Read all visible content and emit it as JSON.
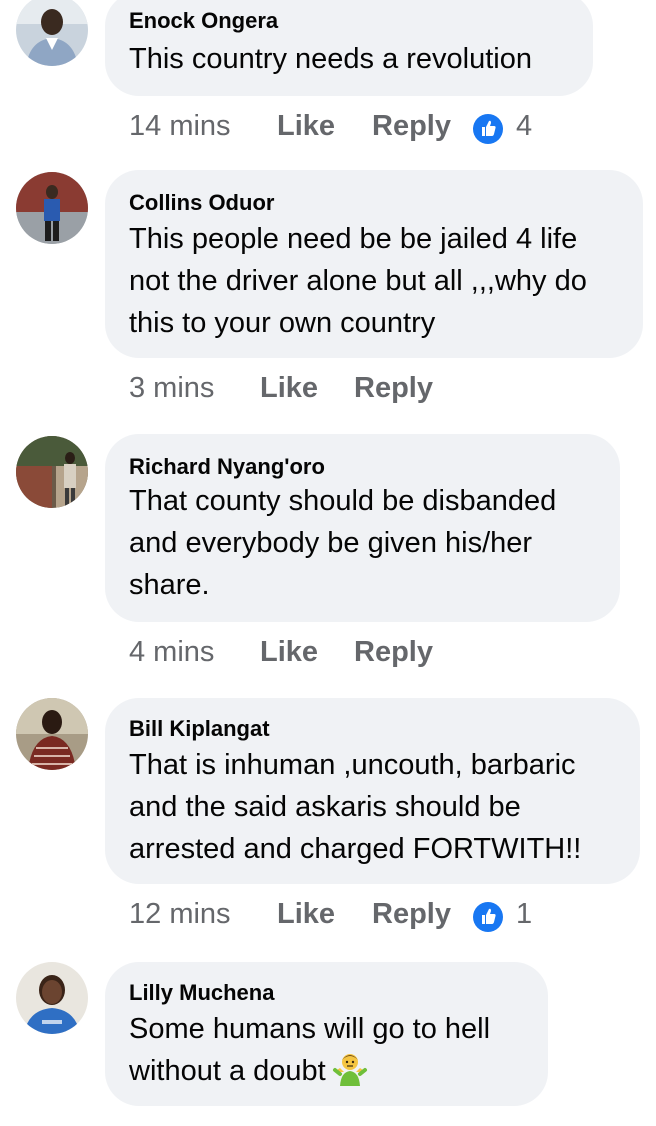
{
  "comments": [
    {
      "author": "Enock Ongera",
      "lines": [
        "This country needs a revolution"
      ],
      "time": "14 mins",
      "like_label": "Like",
      "reply_label": "Reply",
      "reactions": "4"
    },
    {
      "author": "Collins Oduor",
      "lines": [
        "This people need be be jailed 4 life",
        "not the driver alone but all ,,,why do",
        "this to your own country"
      ],
      "time": "3 mins",
      "like_label": "Like",
      "reply_label": "Reply"
    },
    {
      "author": "Richard Nyang'oro",
      "lines": [
        "That county should be disbanded",
        "and everybody be given his/her",
        "share."
      ],
      "time": "4 mins",
      "like_label": "Like",
      "reply_label": "Reply"
    },
    {
      "author": "Bill Kiplangat",
      "lines": [
        "That is inhuman ,uncouth, barbaric",
        "and the said askaris should be",
        "arrested and charged FORTWITH!!"
      ],
      "time": "12 mins",
      "like_label": "Like",
      "reply_label": "Reply",
      "reactions": "1"
    },
    {
      "author": "Lilly Muchena",
      "lines": [
        "Some humans will go to hell",
        "without a doubt"
      ],
      "emoji": "person-shrugging-emoji"
    }
  ],
  "colors": {
    "bubble": "#f0f2f5",
    "meta_text": "#65676b",
    "like_blue": "#1877f2"
  }
}
